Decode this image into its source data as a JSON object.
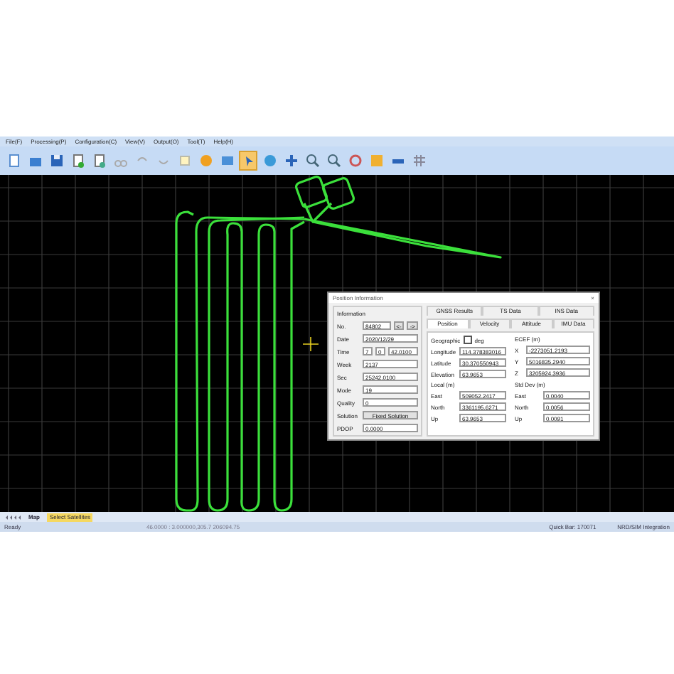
{
  "menu": [
    "File(F)",
    "Processing(P)",
    "Configuration(C)",
    "View(V)",
    "Output(O)",
    "Tool(T)",
    "Help(H)"
  ],
  "toolbar": [
    {
      "selected": false
    },
    {
      "selected": false
    },
    {
      "selected": false
    },
    {
      "selected": false
    },
    {
      "selected": false
    },
    {
      "selected": false
    },
    {
      "selected": false
    },
    {
      "selected": false
    },
    {
      "selected": false
    },
    {
      "selected": false
    },
    {
      "selected": false
    },
    {
      "selected": true
    },
    {
      "selected": false
    },
    {
      "selected": false
    },
    {
      "selected": false
    },
    {
      "selected": false
    },
    {
      "selected": false
    },
    {
      "selected": false
    },
    {
      "selected": false
    },
    {
      "selected": false
    }
  ],
  "dialog": {
    "title": "Position Information",
    "close": "×",
    "info_title": "Information",
    "fields": [
      {
        "label": "No.",
        "values": [
          "84802"
        ],
        "buttons": [
          "<-",
          "->"
        ]
      },
      {
        "label": "Date",
        "values": [
          "2020/12/29"
        ]
      },
      {
        "label": "Time",
        "values": [
          "7",
          "0",
          "42.0100"
        ]
      },
      {
        "label": "Week",
        "values": [
          "2137"
        ]
      },
      {
        "label": "Sec",
        "values": [
          "25242.0100"
        ]
      },
      {
        "label": "Mode",
        "values": [
          "19"
        ]
      },
      {
        "label": "Quality",
        "values": [
          "0"
        ]
      },
      {
        "label": "Solution",
        "values": [
          "Fixed Solution"
        ],
        "kind": "button"
      },
      {
        "label": "PDOP",
        "values": [
          "0.0000"
        ]
      }
    ],
    "tabs_top": [
      {
        "label": "GNSS Results",
        "selected": false
      },
      {
        "label": "TS Data",
        "selected": false
      },
      {
        "label": "INS Data",
        "selected": false
      }
    ],
    "tabs": [
      {
        "label": "Position",
        "selected": true
      },
      {
        "label": "Velocity",
        "selected": false
      },
      {
        "label": "Attitude",
        "selected": false
      },
      {
        "label": "IMU Data",
        "selected": false
      }
    ],
    "geographic": {
      "label": "Geographic",
      "checkbox": "deg",
      "checked": false
    },
    "ecef_title": "ECEF (m)",
    "geo_fields": [
      {
        "label": "Longitude",
        "value": "114.378383016"
      },
      {
        "label": "Latitude",
        "value": "30.370550943"
      },
      {
        "label": "Elevation",
        "value": "63.9653"
      }
    ],
    "ecef_fields": [
      {
        "label": "X",
        "value": "-2273051.2193"
      },
      {
        "label": "Y",
        "value": "5016835.2940"
      },
      {
        "label": "Z",
        "value": "3205924.3936"
      }
    ],
    "local_title": "Local (m)",
    "local_fields": [
      {
        "label": "East",
        "value": "509052.2417"
      },
      {
        "label": "North",
        "value": "3361195.6271"
      },
      {
        "label": "Up",
        "value": "63.9653"
      }
    ],
    "std_title": "Std Dev (m)",
    "std_fields": [
      {
        "label": "East",
        "value": "0.0040"
      },
      {
        "label": "North",
        "value": "0.0056"
      },
      {
        "label": "Up",
        "value": "0.0091"
      }
    ]
  },
  "bottom_tabs": [
    {
      "label": "Map",
      "selected": true
    },
    {
      "label": "Select Satellites",
      "selected": false
    }
  ],
  "status": [
    "Ready",
    "46.0000 : 3.000000,305.7 206094.75",
    "Quick Bar: 170071",
    "NRD/SIM Integration"
  ]
}
